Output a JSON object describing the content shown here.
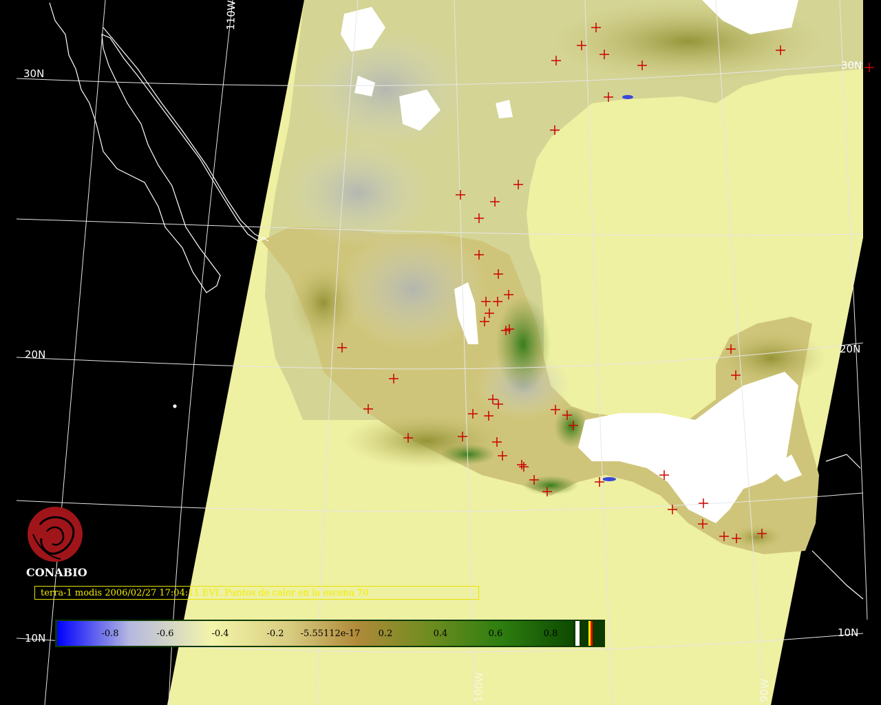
{
  "map": {
    "grid_labels": {
      "lat_30": "30N",
      "lat_20": "20N",
      "lat_20_right": "20N",
      "lat_10": "10N",
      "lat_10_right": "10N",
      "lon_110": "110W",
      "lon_100": "100W",
      "lon_90": "90W",
      "lat_30_right": "30N"
    },
    "colors": {
      "background": "#000000",
      "scene_fill": "#eef0a2",
      "coastline": "#ffffff",
      "hotspot": "#cc0000",
      "grid": "#e0e0e0",
      "cloud": "#ffffff"
    }
  },
  "hotspots_count": 70,
  "branding": {
    "org": "CONABIO"
  },
  "caption": "terra-1 modis 2006/02/27 17:04:11 EVI. Puntos de calor en la escena 70",
  "legend": {
    "ticks": [
      "-0.8",
      "-0.6",
      "-0.4",
      "-0.2",
      "-5.55112e-17",
      "0.2",
      "0.4",
      "0.6",
      "0.8"
    ],
    "gradient": [
      "#0000ff",
      "#b5b8e0",
      "#f3f5aa",
      "#d8cc80",
      "#b08a3a",
      "#6f8c20",
      "#2e7e10",
      "#0d4a00"
    ],
    "special_colors": [
      "#ffffff",
      "#ffff00",
      "#ff0000"
    ]
  }
}
